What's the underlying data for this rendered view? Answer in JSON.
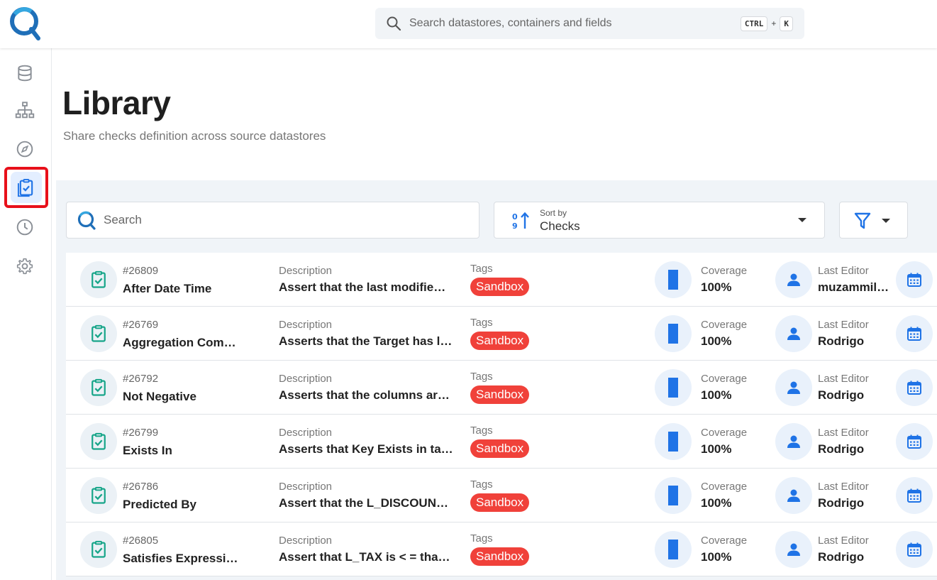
{
  "app": {
    "logo_icon": "qualytics-logo-icon",
    "global_search": {
      "placeholder": "Search datastores, containers and fields",
      "shortcut_ctrl": "CTRL",
      "shortcut_plus": "+",
      "shortcut_key": "K"
    }
  },
  "sidebar": {
    "items": [
      {
        "name": "datastores",
        "icon": "database-icon"
      },
      {
        "name": "explore",
        "icon": "hierarchy-icon"
      },
      {
        "name": "discover",
        "icon": "compass-icon"
      },
      {
        "name": "library",
        "icon": "clipboard-check-icon",
        "active": true
      },
      {
        "name": "activity",
        "icon": "clock-icon"
      },
      {
        "name": "settings",
        "icon": "gear-icon"
      }
    ]
  },
  "header": {
    "title": "Library",
    "subtitle": "Share checks definition across source datastores"
  },
  "toolbar": {
    "search_placeholder": "Search",
    "sort_label": "Sort by",
    "sort_value": "Checks"
  },
  "columns": {
    "description": "Description",
    "tags": "Tags",
    "coverage": "Coverage",
    "last_editor": "Last Editor"
  },
  "rows": [
    {
      "id": "#26809",
      "name": "After Date Time",
      "description": "Assert that the last modifie…",
      "tag": "Sandbox",
      "coverage": "100%",
      "editor": "muzammil…"
    },
    {
      "id": "#26769",
      "name": "Aggregation Com…",
      "description": "Asserts that the Target has l…",
      "tag": "Sandbox",
      "coverage": "100%",
      "editor": "Rodrigo"
    },
    {
      "id": "#26792",
      "name": "Not Negative",
      "description": "Asserts that the columns ar…",
      "tag": "Sandbox",
      "coverage": "100%",
      "editor": "Rodrigo"
    },
    {
      "id": "#26799",
      "name": "Exists In",
      "description": "Asserts that Key Exists in ta…",
      "tag": "Sandbox",
      "coverage": "100%",
      "editor": "Rodrigo"
    },
    {
      "id": "#26786",
      "name": "Predicted By",
      "description": "Assert that the L_DISCOUN…",
      "tag": "Sandbox",
      "coverage": "100%",
      "editor": "Rodrigo"
    },
    {
      "id": "#26805",
      "name": "Satisfies Expressi…",
      "description": "Assert that L_TAX is < = tha…",
      "tag": "Sandbox",
      "coverage": "100%",
      "editor": "Rodrigo"
    }
  ],
  "colors": {
    "accent": "#1f73e6",
    "tag_red": "#f0413a",
    "check_green": "#17a589",
    "highlight_red": "#e8101a"
  }
}
